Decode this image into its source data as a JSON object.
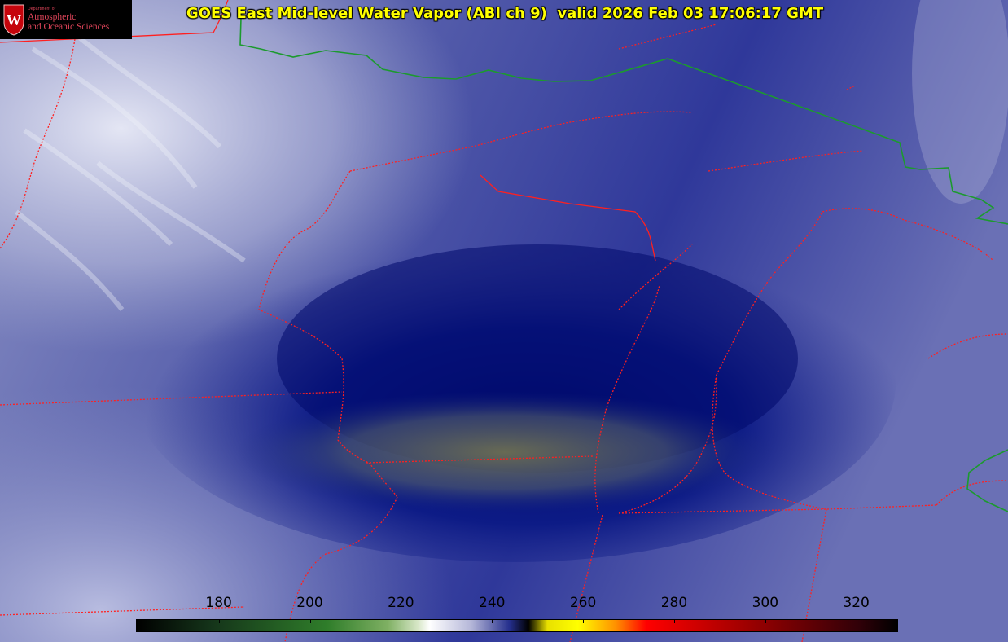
{
  "title": "GOES East Mid-level Water Vapor (ABI ch 9)  valid 2026 Feb 03 17:06:17 GMT",
  "logo": {
    "line_small": "Department of",
    "line1": "Atmospheric",
    "line2": "and Oceanic Sciences",
    "badge_letter": "W"
  },
  "colorbar": {
    "ticks": [
      "180",
      "200",
      "220",
      "240",
      "260",
      "280",
      "300",
      "320"
    ],
    "min": 162,
    "max": 329
  },
  "colors": {
    "state_border": "#ff2020",
    "country_border": "#1c9a2e",
    "title": "#ffff00"
  }
}
